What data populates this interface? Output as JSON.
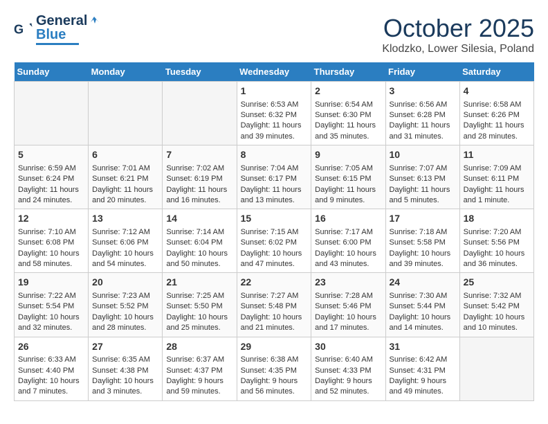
{
  "header": {
    "logo_general": "General",
    "logo_blue": "Blue",
    "month": "October 2025",
    "location": "Klodzko, Lower Silesia, Poland"
  },
  "days_of_week": [
    "Sunday",
    "Monday",
    "Tuesday",
    "Wednesday",
    "Thursday",
    "Friday",
    "Saturday"
  ],
  "weeks": [
    [
      {
        "day": "",
        "data": []
      },
      {
        "day": "",
        "data": []
      },
      {
        "day": "",
        "data": []
      },
      {
        "day": "1",
        "data": [
          "Sunrise: 6:53 AM",
          "Sunset: 6:32 PM",
          "Daylight: 11 hours",
          "and 39 minutes."
        ]
      },
      {
        "day": "2",
        "data": [
          "Sunrise: 6:54 AM",
          "Sunset: 6:30 PM",
          "Daylight: 11 hours",
          "and 35 minutes."
        ]
      },
      {
        "day": "3",
        "data": [
          "Sunrise: 6:56 AM",
          "Sunset: 6:28 PM",
          "Daylight: 11 hours",
          "and 31 minutes."
        ]
      },
      {
        "day": "4",
        "data": [
          "Sunrise: 6:58 AM",
          "Sunset: 6:26 PM",
          "Daylight: 11 hours",
          "and 28 minutes."
        ]
      }
    ],
    [
      {
        "day": "5",
        "data": [
          "Sunrise: 6:59 AM",
          "Sunset: 6:24 PM",
          "Daylight: 11 hours",
          "and 24 minutes."
        ]
      },
      {
        "day": "6",
        "data": [
          "Sunrise: 7:01 AM",
          "Sunset: 6:21 PM",
          "Daylight: 11 hours",
          "and 20 minutes."
        ]
      },
      {
        "day": "7",
        "data": [
          "Sunrise: 7:02 AM",
          "Sunset: 6:19 PM",
          "Daylight: 11 hours",
          "and 16 minutes."
        ]
      },
      {
        "day": "8",
        "data": [
          "Sunrise: 7:04 AM",
          "Sunset: 6:17 PM",
          "Daylight: 11 hours",
          "and 13 minutes."
        ]
      },
      {
        "day": "9",
        "data": [
          "Sunrise: 7:05 AM",
          "Sunset: 6:15 PM",
          "Daylight: 11 hours",
          "and 9 minutes."
        ]
      },
      {
        "day": "10",
        "data": [
          "Sunrise: 7:07 AM",
          "Sunset: 6:13 PM",
          "Daylight: 11 hours",
          "and 5 minutes."
        ]
      },
      {
        "day": "11",
        "data": [
          "Sunrise: 7:09 AM",
          "Sunset: 6:11 PM",
          "Daylight: 11 hours",
          "and 1 minute."
        ]
      }
    ],
    [
      {
        "day": "12",
        "data": [
          "Sunrise: 7:10 AM",
          "Sunset: 6:08 PM",
          "Daylight: 10 hours",
          "and 58 minutes."
        ]
      },
      {
        "day": "13",
        "data": [
          "Sunrise: 7:12 AM",
          "Sunset: 6:06 PM",
          "Daylight: 10 hours",
          "and 54 minutes."
        ]
      },
      {
        "day": "14",
        "data": [
          "Sunrise: 7:14 AM",
          "Sunset: 6:04 PM",
          "Daylight: 10 hours",
          "and 50 minutes."
        ]
      },
      {
        "day": "15",
        "data": [
          "Sunrise: 7:15 AM",
          "Sunset: 6:02 PM",
          "Daylight: 10 hours",
          "and 47 minutes."
        ]
      },
      {
        "day": "16",
        "data": [
          "Sunrise: 7:17 AM",
          "Sunset: 6:00 PM",
          "Daylight: 10 hours",
          "and 43 minutes."
        ]
      },
      {
        "day": "17",
        "data": [
          "Sunrise: 7:18 AM",
          "Sunset: 5:58 PM",
          "Daylight: 10 hours",
          "and 39 minutes."
        ]
      },
      {
        "day": "18",
        "data": [
          "Sunrise: 7:20 AM",
          "Sunset: 5:56 PM",
          "Daylight: 10 hours",
          "and 36 minutes."
        ]
      }
    ],
    [
      {
        "day": "19",
        "data": [
          "Sunrise: 7:22 AM",
          "Sunset: 5:54 PM",
          "Daylight: 10 hours",
          "and 32 minutes."
        ]
      },
      {
        "day": "20",
        "data": [
          "Sunrise: 7:23 AM",
          "Sunset: 5:52 PM",
          "Daylight: 10 hours",
          "and 28 minutes."
        ]
      },
      {
        "day": "21",
        "data": [
          "Sunrise: 7:25 AM",
          "Sunset: 5:50 PM",
          "Daylight: 10 hours",
          "and 25 minutes."
        ]
      },
      {
        "day": "22",
        "data": [
          "Sunrise: 7:27 AM",
          "Sunset: 5:48 PM",
          "Daylight: 10 hours",
          "and 21 minutes."
        ]
      },
      {
        "day": "23",
        "data": [
          "Sunrise: 7:28 AM",
          "Sunset: 5:46 PM",
          "Daylight: 10 hours",
          "and 17 minutes."
        ]
      },
      {
        "day": "24",
        "data": [
          "Sunrise: 7:30 AM",
          "Sunset: 5:44 PM",
          "Daylight: 10 hours",
          "and 14 minutes."
        ]
      },
      {
        "day": "25",
        "data": [
          "Sunrise: 7:32 AM",
          "Sunset: 5:42 PM",
          "Daylight: 10 hours",
          "and 10 minutes."
        ]
      }
    ],
    [
      {
        "day": "26",
        "data": [
          "Sunrise: 6:33 AM",
          "Sunset: 4:40 PM",
          "Daylight: 10 hours",
          "and 7 minutes."
        ]
      },
      {
        "day": "27",
        "data": [
          "Sunrise: 6:35 AM",
          "Sunset: 4:38 PM",
          "Daylight: 10 hours",
          "and 3 minutes."
        ]
      },
      {
        "day": "28",
        "data": [
          "Sunrise: 6:37 AM",
          "Sunset: 4:37 PM",
          "Daylight: 9 hours",
          "and 59 minutes."
        ]
      },
      {
        "day": "29",
        "data": [
          "Sunrise: 6:38 AM",
          "Sunset: 4:35 PM",
          "Daylight: 9 hours",
          "and 56 minutes."
        ]
      },
      {
        "day": "30",
        "data": [
          "Sunrise: 6:40 AM",
          "Sunset: 4:33 PM",
          "Daylight: 9 hours",
          "and 52 minutes."
        ]
      },
      {
        "day": "31",
        "data": [
          "Sunrise: 6:42 AM",
          "Sunset: 4:31 PM",
          "Daylight: 9 hours",
          "and 49 minutes."
        ]
      },
      {
        "day": "",
        "data": []
      }
    ]
  ]
}
